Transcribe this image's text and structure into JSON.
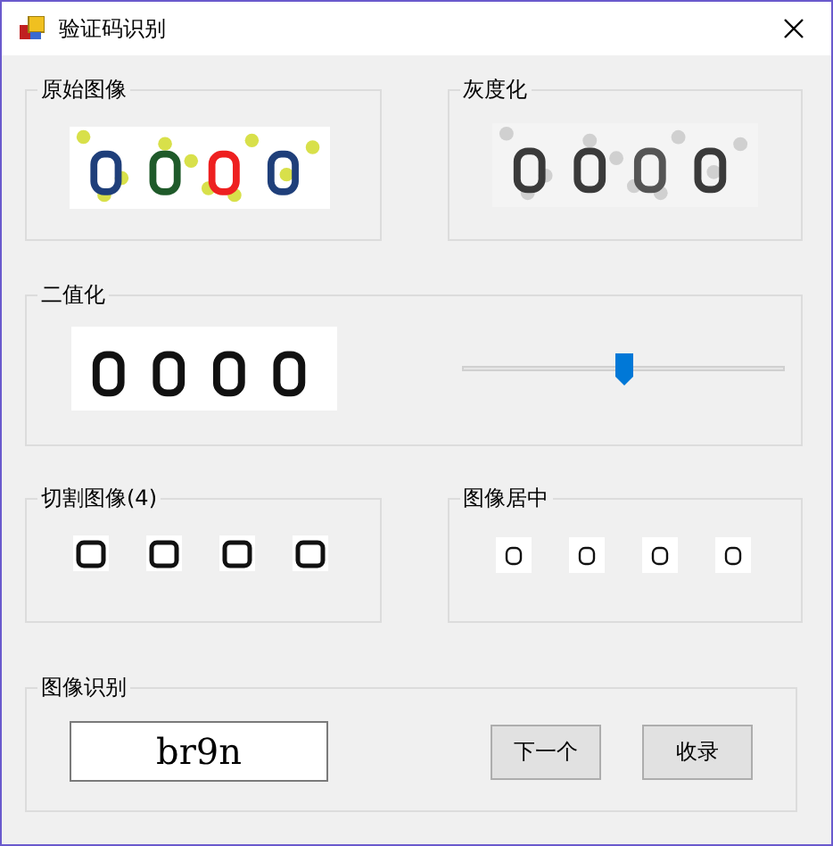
{
  "window": {
    "title": "验证码识别"
  },
  "original_image": {
    "label": "原始图像"
  },
  "grayscale": {
    "label": "灰度化"
  },
  "binarize": {
    "label": "二值化",
    "threshold": {
      "level": 0.5
    }
  },
  "segments": {
    "label": "切割图像(4)"
  },
  "centered": {
    "label": "图像居中"
  },
  "recognition": {
    "label": "图像识别",
    "result": "br9n",
    "buttons": [
      "下一个",
      "收录"
    ]
  }
}
